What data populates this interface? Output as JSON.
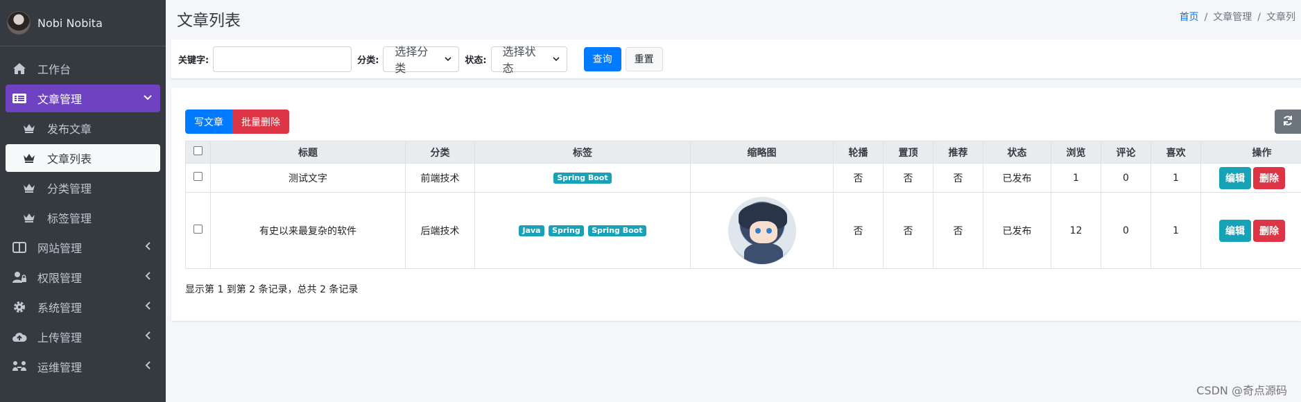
{
  "user": {
    "name": "Nobi Nobita"
  },
  "sidebar": {
    "items": [
      {
        "label": "工作台",
        "icon": "home-icon"
      },
      {
        "label": "文章管理",
        "icon": "list-alt-icon",
        "active": true,
        "children": [
          {
            "label": "发布文章",
            "icon": "crown-icon"
          },
          {
            "label": "文章列表",
            "icon": "crown-icon",
            "active": true
          },
          {
            "label": "分类管理",
            "icon": "crown-icon"
          },
          {
            "label": "标签管理",
            "icon": "crown-icon"
          }
        ]
      },
      {
        "label": "网站管理",
        "icon": "columns-icon"
      },
      {
        "label": "权限管理",
        "icon": "user-lock-icon"
      },
      {
        "label": "系统管理",
        "icon": "gear-icon"
      },
      {
        "label": "上传管理",
        "icon": "cloud-upload-icon"
      },
      {
        "label": "运维管理",
        "icon": "people-icon"
      }
    ]
  },
  "header": {
    "title": "文章列表",
    "breadcrumb": [
      "首页",
      "文章管理",
      "文章列"
    ]
  },
  "filters": {
    "keyword_label": "关键字:",
    "keyword_value": "",
    "category_label": "分类:",
    "category_value": "选择分类",
    "status_label": "状态:",
    "status_value": "选择状态",
    "query_button": "查询",
    "reset_button": "重置"
  },
  "toolbar": {
    "write_button": "写文章",
    "batch_delete_button": "批量删除"
  },
  "table": {
    "columns": [
      "标题",
      "分类",
      "标签",
      "缩略图",
      "轮播",
      "置顶",
      "推荐",
      "状态",
      "浏览",
      "评论",
      "喜欢",
      "操作"
    ],
    "rows": [
      {
        "title": "测试文字",
        "category": "前端技术",
        "tags": [
          "Spring Boot"
        ],
        "has_thumb": false,
        "carousel": "否",
        "top": "否",
        "recommend": "否",
        "status": "已发布",
        "views": "1",
        "comments": "0",
        "likes": "1",
        "edit": "编辑",
        "delete": "删除"
      },
      {
        "title": "有史以来最复杂的软件",
        "category": "后端技术",
        "tags": [
          "Java",
          "Spring",
          "Spring Boot"
        ],
        "has_thumb": true,
        "carousel": "否",
        "top": "否",
        "recommend": "否",
        "status": "已发布",
        "views": "12",
        "comments": "0",
        "likes": "1",
        "edit": "编辑",
        "delete": "删除"
      }
    ]
  },
  "summary": "显示第 1 到第 2 条记录，总共 2 条记录",
  "watermark": "CSDN @奇点源码",
  "colors": {
    "sidebar_bg": "#343a40",
    "active_nav": "#6f42c1",
    "primary": "#007bff",
    "danger": "#dc3545",
    "info": "#17a2b8"
  }
}
